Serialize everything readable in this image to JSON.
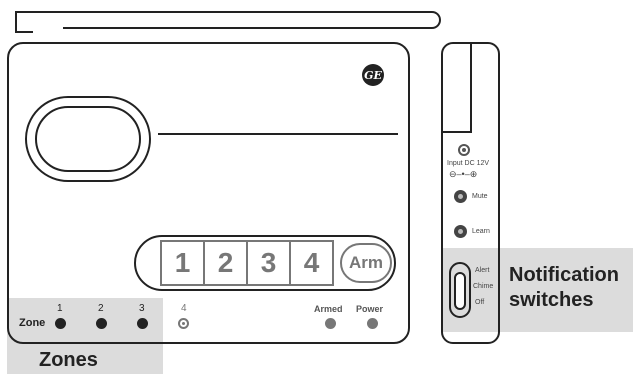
{
  "logo": {
    "text": "GE"
  },
  "keypad": {
    "keys": [
      "1",
      "2",
      "3",
      "4"
    ],
    "arm_label": "Arm"
  },
  "zones": {
    "word": "Zone",
    "numbers": [
      "1",
      "2",
      "3",
      "4"
    ]
  },
  "status": {
    "armed_label": "Armed",
    "power_label": "Power"
  },
  "side_panel": {
    "input_label": "Input DC 12V",
    "polarity_label": "⊖–•–⊕",
    "mute_label": "Mute",
    "learn_label": "Learn",
    "switch_positions": [
      "Alert",
      "Chime",
      "Off"
    ]
  },
  "callouts": {
    "zones": "Zones",
    "notification_line1": "Notification",
    "notification_line2": "switches"
  }
}
